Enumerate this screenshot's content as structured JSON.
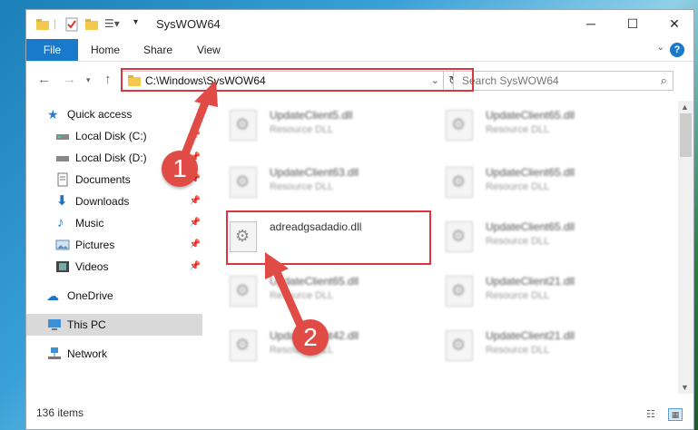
{
  "window": {
    "title": "SysWOW64",
    "minimize": "─",
    "maximize": "☐",
    "close": "✕"
  },
  "ribbon": {
    "file": "File",
    "home": "Home",
    "share": "Share",
    "view": "View",
    "help": "?"
  },
  "nav": {
    "address": "C:\\Windows\\SysWOW64",
    "search_placeholder": "Search SysWOW64"
  },
  "sidebar": {
    "items": [
      {
        "label": "Quick access",
        "icon": "star-icon"
      },
      {
        "label": "Local Disk (C:)",
        "icon": "drive-icon",
        "pinned": true
      },
      {
        "label": "Local Disk (D:)",
        "icon": "drive-icon",
        "pinned": true
      },
      {
        "label": "Documents",
        "icon": "documents-icon",
        "pinned": true
      },
      {
        "label": "Downloads",
        "icon": "downloads-icon",
        "pinned": true
      },
      {
        "label": "Music",
        "icon": "music-icon",
        "pinned": true
      },
      {
        "label": "Pictures",
        "icon": "pictures-icon",
        "pinned": true
      },
      {
        "label": "Videos",
        "icon": "videos-icon",
        "pinned": true
      },
      {
        "label": "OneDrive",
        "icon": "cloud-icon"
      },
      {
        "label": "This PC",
        "icon": "computer-icon",
        "selected": true
      },
      {
        "label": "Network",
        "icon": "network-icon"
      }
    ]
  },
  "files": [
    {
      "name": "UpdateClient5.dll",
      "type": "Resource DLL"
    },
    {
      "name": "UpdateClient65.dll",
      "type": "Resource DLL"
    },
    {
      "name": "UpdateClient63.dll",
      "type": "Resource DLL"
    },
    {
      "name": "UpdateClient65.dll",
      "type": "Resource DLL"
    },
    {
      "name": "adreadgsadadio.dll",
      "type": ""
    },
    {
      "name": "UpdateClient65.dll",
      "type": "Resource DLL"
    },
    {
      "name": "UpdateClient65.dll",
      "type": "Resource DLL"
    },
    {
      "name": "UpdateClient21.dll",
      "type": "Resource DLL"
    },
    {
      "name": "UpdateClient42.dll",
      "type": "Resource DLL"
    },
    {
      "name": "UpdateClient21.dll",
      "type": "Resource DLL"
    }
  ],
  "status": {
    "count": "136 items"
  },
  "annotations": {
    "step1": "1",
    "step2": "2",
    "color": "#e04b46"
  }
}
